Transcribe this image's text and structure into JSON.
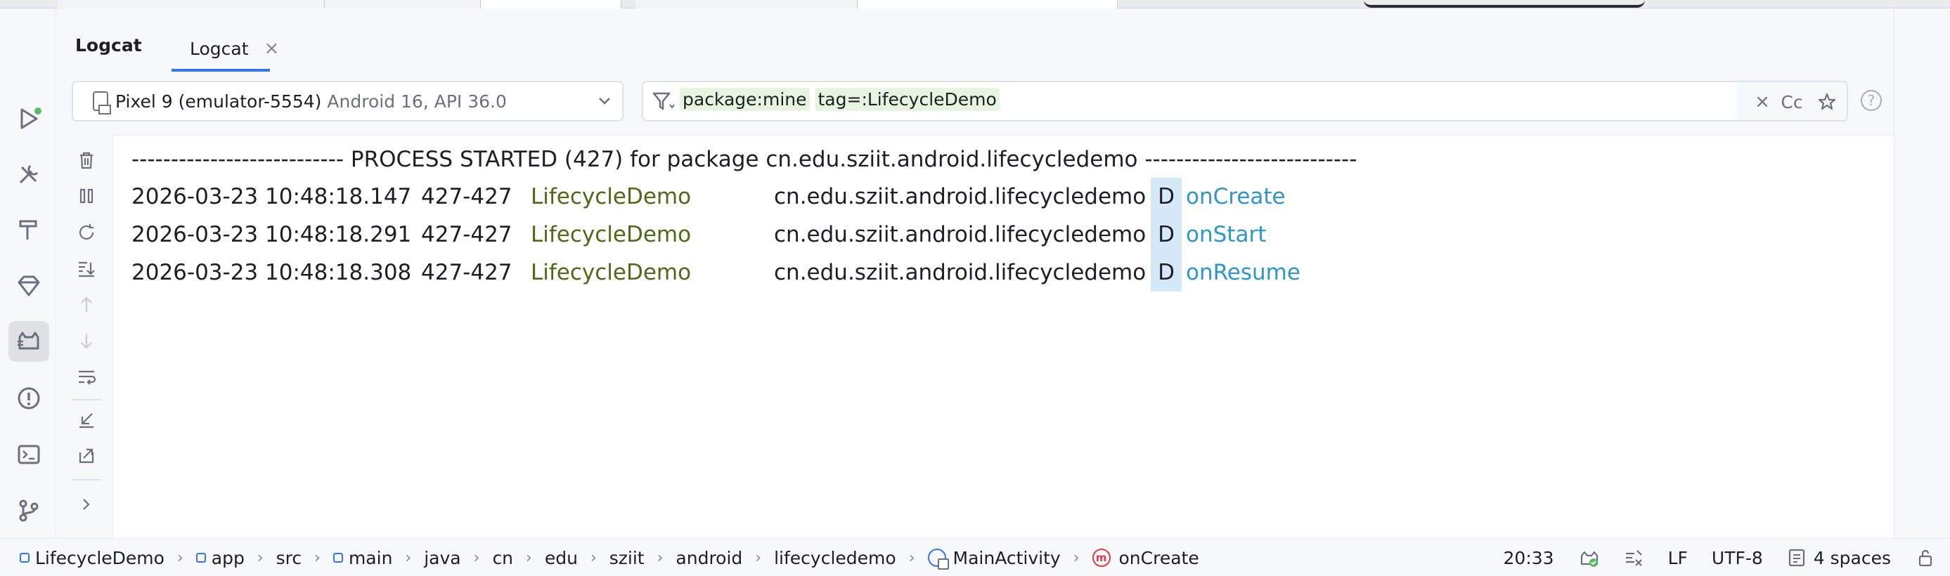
{
  "tool_window": {
    "title": "Logcat",
    "tab_label": "Logcat"
  },
  "device_selector": {
    "device": "Pixel 9 (emulator-5554)",
    "api": "Android 16, API 36.0"
  },
  "filter": {
    "term1": "package:mine",
    "term2": "tag=:LifecycleDemo",
    "clear_icon": "close-icon",
    "match_case_label": "Cc"
  },
  "log": {
    "header": "--------------------------- PROCESS STARTED (427) for package cn.edu.sziit.android.lifecycledemo ---------------------------",
    "rows": [
      {
        "timestamp": "2026-03-23 10:48:18.147",
        "pid": "427-427",
        "tag": "LifecycleDemo",
        "package": "cn.edu.sziit.android.lifecycledemo",
        "level": "D",
        "message": "onCreate"
      },
      {
        "timestamp": "2026-03-23 10:48:18.291",
        "pid": "427-427",
        "tag": "LifecycleDemo",
        "package": "cn.edu.sziit.android.lifecycledemo",
        "level": "D",
        "message": "onStart"
      },
      {
        "timestamp": "2026-03-23 10:48:18.308",
        "pid": "427-427",
        "tag": "LifecycleDemo",
        "package": "cn.edu.sziit.android.lifecycledemo",
        "level": "D",
        "message": "onResume"
      }
    ]
  },
  "breadcrumbs": [
    "LifecycleDemo",
    "app",
    "src",
    "main",
    "java",
    "cn",
    "edu",
    "sziit",
    "android",
    "lifecycledemo",
    "MainActivity",
    "onCreate"
  ],
  "status": {
    "position": "20:33",
    "line_ending": "LF",
    "encoding": "UTF-8",
    "indent": "4 spaces"
  },
  "colors": {
    "accent": "#3574f0",
    "tag": "#4e6a19",
    "message": "#2f96c9",
    "level_bg": "#d6e9fb"
  }
}
